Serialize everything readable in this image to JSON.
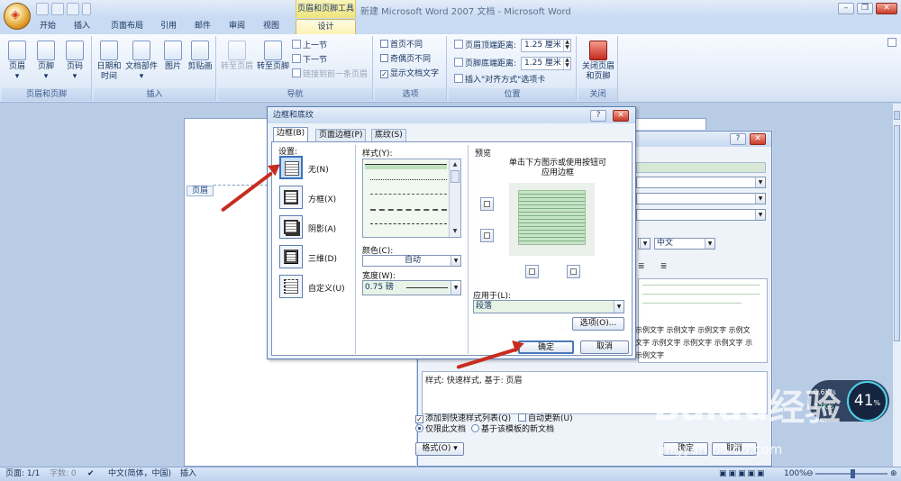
{
  "window": {
    "title": "新建 Microsoft Word 2007 文档 - Microsoft Word",
    "context_tab": "页眉和页脚工具"
  },
  "tabs": [
    "开始",
    "插入",
    "页面布局",
    "引用",
    "邮件",
    "审阅",
    "视图",
    "设计"
  ],
  "ribbon": {
    "groups": {
      "header_footer": {
        "label": "页眉和页脚",
        "buttons": [
          "页眉",
          "页脚",
          "页码"
        ]
      },
      "insert": {
        "label": "插入",
        "buttons": [
          "日期和\n时间",
          "文档部件",
          "图片",
          "剪贴画"
        ]
      },
      "nav": {
        "label": "导航",
        "go_header": "转至页眉",
        "go_footer": "转至页脚",
        "prev": "上一节",
        "next": "下一节",
        "link_prev": "链接到前一条页眉"
      },
      "options": {
        "label": "选项",
        "first_page": "首页不同",
        "odd_even": "奇偶页不同",
        "show_text": "显示文档文字"
      },
      "position": {
        "label": "位置",
        "header_top_label": "页眉顶端距离:",
        "header_top_value": "1.25 厘米",
        "footer_bottom_label": "页脚底端距离:",
        "footer_bottom_value": "1.25 厘米",
        "insert_align": "插入\"对齐方式\"选项卡"
      },
      "close": {
        "label": "关闭",
        "button": "关闭页眉\n和页脚"
      }
    }
  },
  "document": {
    "header_label": "页眉"
  },
  "style_dialog": {
    "font_value": "中文",
    "sample_text_1": "示例文字 示例文字 示例文字 示例文",
    "sample_text_2": "文字 示例文字 示例文字 示例文字 示",
    "sample_text_3": "示例文字",
    "description": "样式: 快速样式, 基于: 页眉",
    "add_to_quick": "添加到快速样式列表(Q)",
    "auto_update": "自动更新(U)",
    "only_this_doc": "仅限此文档",
    "template_docs": "基于该模板的新文档",
    "format_button": "格式(O) ▾",
    "ok": "确定",
    "cancel": "取消"
  },
  "borders_dialog": {
    "title": "边框和底纹",
    "tabs": [
      "边框(B)",
      "页面边框(P)",
      "底纹(S)"
    ],
    "settings_label": "设置:",
    "settings": [
      "无(N)",
      "方框(X)",
      "阴影(A)",
      "三维(D)",
      "自定义(U)"
    ],
    "style_label": "样式(Y):",
    "color_label": "颜色(C):",
    "color_value": "自动",
    "width_label": "宽度(W):",
    "width_value": "0.75 磅",
    "preview_label": "预览",
    "preview_hint": "单击下方图示或使用按钮可\n应用边框",
    "apply_label": "应用于(L):",
    "apply_value": "段落",
    "options_button": "选项(O)...",
    "ok": "确定",
    "cancel": "取消"
  },
  "status": {
    "page": "页面: 1/1",
    "words": "字数: 0",
    "language": "中文(简体，中国)",
    "mode": "插入",
    "zoom": "100%"
  },
  "overlay": {
    "speed_up": "0.6K/s",
    "speed_down": "27K/s",
    "cpu_percent": "41",
    "watermark": "Baidu经验",
    "watermark_url": "jingyan.baidu.com"
  },
  "colors": {
    "arrow": "#c72d1f",
    "ribbon_bg": "#e3ecf9",
    "context_tab": "#efe37c",
    "preview_green": "#c7e4c7"
  }
}
